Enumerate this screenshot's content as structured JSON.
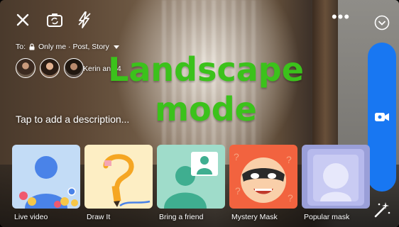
{
  "top_bar": {
    "close_icon": "close-icon",
    "flip_icon": "camera-flip-icon",
    "flash_icon": "flash-off-icon",
    "more_label": "•••",
    "collapse_icon": "chevron-down-circle-icon"
  },
  "audience": {
    "prefix": "To:",
    "lock_icon": "lock-icon",
    "value": "Only me · Post, Story"
  },
  "friends": {
    "text": "Kerin and 4"
  },
  "description": {
    "placeholder": "Tap to add a description..."
  },
  "overlay": {
    "line1": "Landscape",
    "line2": "mode",
    "color": "#3bc21b"
  },
  "live_button": {
    "icon": "video-camera-icon",
    "color": "#1877f2"
  },
  "effects_icon": "magic-wand-icon",
  "effects": [
    {
      "label": "Live video",
      "icon": "live-video-thumbnail"
    },
    {
      "label": "Draw It",
      "icon": "draw-it-thumbnail"
    },
    {
      "label": "Bring a friend",
      "icon": "bring-a-friend-thumbnail"
    },
    {
      "label": "Mystery Mask",
      "icon": "mystery-mask-thumbnail"
    },
    {
      "label": "Popular mask",
      "icon": "popular-mask-thumbnail"
    }
  ]
}
